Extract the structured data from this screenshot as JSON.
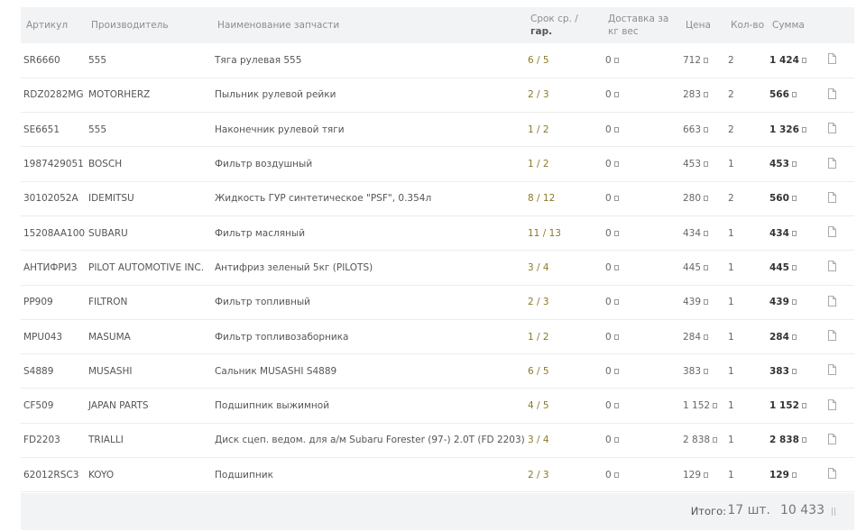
{
  "columns": {
    "article": "Артикул",
    "maker": "Производитель",
    "name": "Наименование запчасти",
    "term_prefix": "Срок ср. /",
    "term_bold": "гар.",
    "delivery": "Доставка за кг вес",
    "price": "Цена",
    "qty": "Кол-во",
    "sum": "Сумма"
  },
  "rows": [
    {
      "article": "SR6660",
      "maker": "555",
      "name": "Тяга рулевая 555",
      "term": "6 / 5",
      "delivery": "0",
      "price": "712",
      "qty": "2",
      "sum": "1 424"
    },
    {
      "article": "RDZ0282MG",
      "maker": "MOTORHERZ",
      "name": "Пыльник рулевой рейки",
      "term": "2 / 3",
      "delivery": "0",
      "price": "283",
      "qty": "2",
      "sum": "566"
    },
    {
      "article": "SE6651",
      "maker": "555",
      "name": "Наконечник рулевой тяги",
      "term": "1 / 2",
      "delivery": "0",
      "price": "663",
      "qty": "2",
      "sum": "1 326"
    },
    {
      "article": "1987429051",
      "maker": "BOSCH",
      "name": "Фильтр воздушный",
      "term": "1 / 2",
      "delivery": "0",
      "price": "453",
      "qty": "1",
      "sum": "453"
    },
    {
      "article": "30102052A",
      "maker": "IDEMITSU",
      "name": "Жидкость ГУР синтетическое \"PSF\", 0.354л",
      "term": "8 / 12",
      "delivery": "0",
      "price": "280",
      "qty": "2",
      "sum": "560"
    },
    {
      "article": "15208AA100",
      "maker": "SUBARU",
      "name": "Фильтр масляный",
      "term": "11 / 13",
      "delivery": "0",
      "price": "434",
      "qty": "1",
      "sum": "434"
    },
    {
      "article": "АНТИФРИЗ",
      "maker": "PILOT AUTOMOTIVE INC.",
      "name": "Антифриз зеленый 5кг (PILOTS)",
      "term": "3 / 4",
      "delivery": "0",
      "price": "445",
      "qty": "1",
      "sum": "445"
    },
    {
      "article": "PP909",
      "maker": "FILTRON",
      "name": "Фильтр топливный",
      "term": "2 / 3",
      "delivery": "0",
      "price": "439",
      "qty": "1",
      "sum": "439"
    },
    {
      "article": "MPU043",
      "maker": "MASUMA",
      "name": "Фильтр топливозаборника",
      "term": "1 / 2",
      "delivery": "0",
      "price": "284",
      "qty": "1",
      "sum": "284"
    },
    {
      "article": "S4889",
      "maker": "MUSASHI",
      "name": "Сальник MUSASHI S4889",
      "term": "6 / 5",
      "delivery": "0",
      "price": "383",
      "qty": "1",
      "sum": "383"
    },
    {
      "article": "CF509",
      "maker": "JAPAN PARTS",
      "name": "Подшипник выжимной",
      "term": "4 / 5",
      "delivery": "0",
      "price": "1 152",
      "qty": "1",
      "sum": "1 152"
    },
    {
      "article": "FD2203",
      "maker": "TRIALLI",
      "name": "Диск сцеп. ведом. для а/м Subaru Forester (97-) 2.0T (FD 2203)",
      "term": "3 / 4",
      "delivery": "0",
      "price": "2 838",
      "qty": "1",
      "sum": "2 838"
    },
    {
      "article": "62012RSC3",
      "maker": "KOYO",
      "name": "Подшипник",
      "term": "2 / 3",
      "delivery": "0",
      "price": "129",
      "qty": "1",
      "sum": "129"
    }
  ],
  "footer": {
    "label": "Итого:",
    "count": "17 шт.",
    "total": "10 433"
  },
  "colors": {
    "term_text": "#8a7a2a",
    "header_bg": "#f2f3f4"
  },
  "icons": {
    "row_action": "document-icon",
    "currency": "ruble-icon"
  }
}
